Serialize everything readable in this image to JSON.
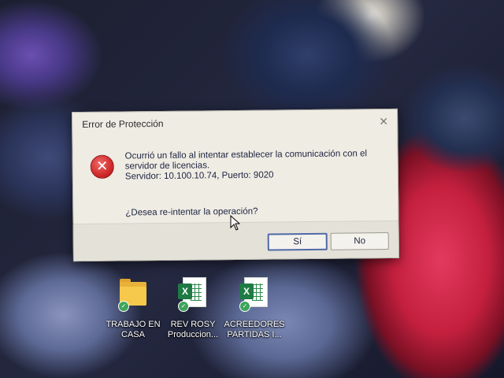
{
  "dialog": {
    "title": "Error de Protección",
    "message_line1": "Ocurrió un fallo al intentar establecer la comunicación con el",
    "message_line2": "servidor de licencias.",
    "message_line3": "Servidor: 10.100.10.74, Puerto: 9020",
    "question": "¿Desea re-intentar la operación?",
    "yes_label": "Sí",
    "no_label": "No",
    "icon": "error-icon",
    "close_glyph": "✕"
  },
  "desktop_icons": [
    {
      "line1": "TRABAJO EN",
      "line2": "CASA",
      "icon": "folder-icon"
    },
    {
      "line1": "REV ROSY",
      "line2": "Produccion...",
      "icon": "excel-file-icon"
    },
    {
      "line1": "ACREEDORES",
      "line2": "PARTIDAS I...",
      "icon": "excel-file-icon"
    }
  ],
  "colors": {
    "dialog_bg": "#efece4",
    "error_red": "#d12a2a",
    "default_button_border": "#4f6aa8",
    "excel_green": "#1f7a44",
    "folder_yellow": "#f6c84b"
  }
}
